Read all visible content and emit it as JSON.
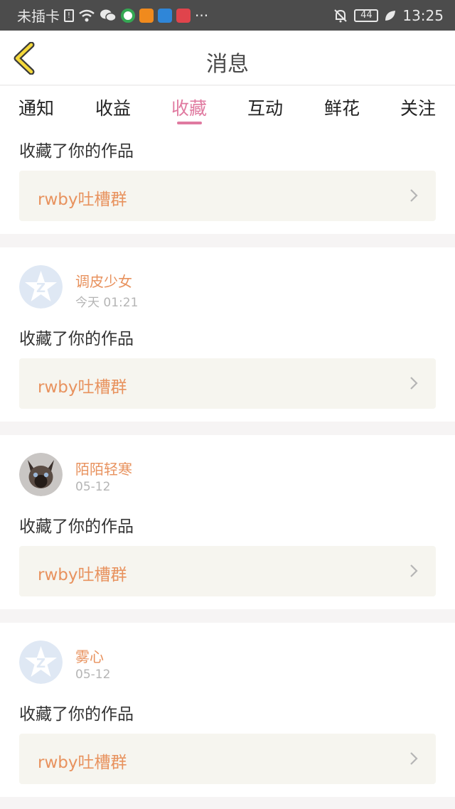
{
  "status_bar": {
    "carrier": "未插卡",
    "battery": "44",
    "time": "13:25",
    "more": "···"
  },
  "header": {
    "title": "消息"
  },
  "tabs": [
    {
      "label": "通知"
    },
    {
      "label": "收益"
    },
    {
      "label": "收藏"
    },
    {
      "label": "互动"
    },
    {
      "label": "鲜花"
    },
    {
      "label": "关注"
    }
  ],
  "active_tab": 2,
  "items": [
    {
      "message": "收藏了你的作品",
      "work": "rwby吐槽群"
    },
    {
      "name": "调皮少女",
      "time": "今天 01:21",
      "avatar": "default-avatar-icon",
      "message": "收藏了你的作品",
      "work": "rwby吐槽群"
    },
    {
      "name": "陌陌轻寒",
      "time": "05-12",
      "avatar": "cat-photo",
      "message": "收藏了你的作品",
      "work": "rwby吐槽群"
    },
    {
      "name": "雾心",
      "time": "05-12",
      "avatar": "default-avatar-icon",
      "message": "收藏了你的作品",
      "work": "rwby吐槽群"
    }
  ],
  "colors": {
    "accent": "#e07aa0",
    "name": "#e8925e",
    "status_bar": "#4c4c4c"
  }
}
